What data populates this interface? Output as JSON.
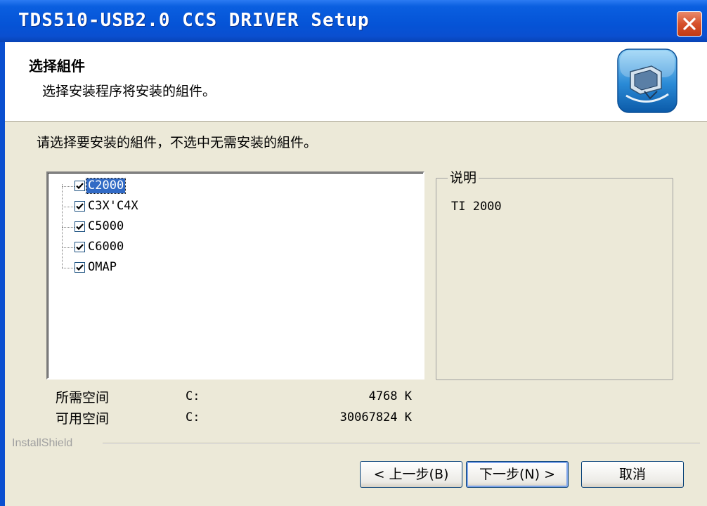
{
  "window": {
    "title": "TDS510-USB2.0 CCS DRIVER Setup"
  },
  "header": {
    "title": "选择組件",
    "subtitle": "选择安装程序将安装的組件。"
  },
  "instruction": "请选择要安装的組件，不选中无需安装的組件。",
  "components": [
    {
      "label": "C2000",
      "checked": true,
      "selected": true
    },
    {
      "label": "C3X'C4X",
      "checked": true,
      "selected": false
    },
    {
      "label": "C5000",
      "checked": true,
      "selected": false
    },
    {
      "label": "C6000",
      "checked": true,
      "selected": false
    },
    {
      "label": "OMAP",
      "checked": true,
      "selected": false
    }
  ],
  "description": {
    "legend": "说明",
    "text": "TI 2000"
  },
  "space": {
    "required": {
      "label": "所需空间",
      "drive": "C:",
      "value": "4768 K"
    },
    "available": {
      "label": "可用空间",
      "drive": "C:",
      "value": "30067824 K"
    }
  },
  "brand": "InstallShield",
  "buttons": {
    "back": "< 上一步(B)",
    "next": "下一步(N) >",
    "cancel": "取消"
  },
  "colors": {
    "titlebar": "#0553d6",
    "selection": "#316ac5",
    "dialog_bg": "#ece9d8",
    "close": "#d6502b"
  },
  "icons": {
    "header": "computer-setup-icon",
    "close": "close-icon",
    "check": "check-icon"
  }
}
